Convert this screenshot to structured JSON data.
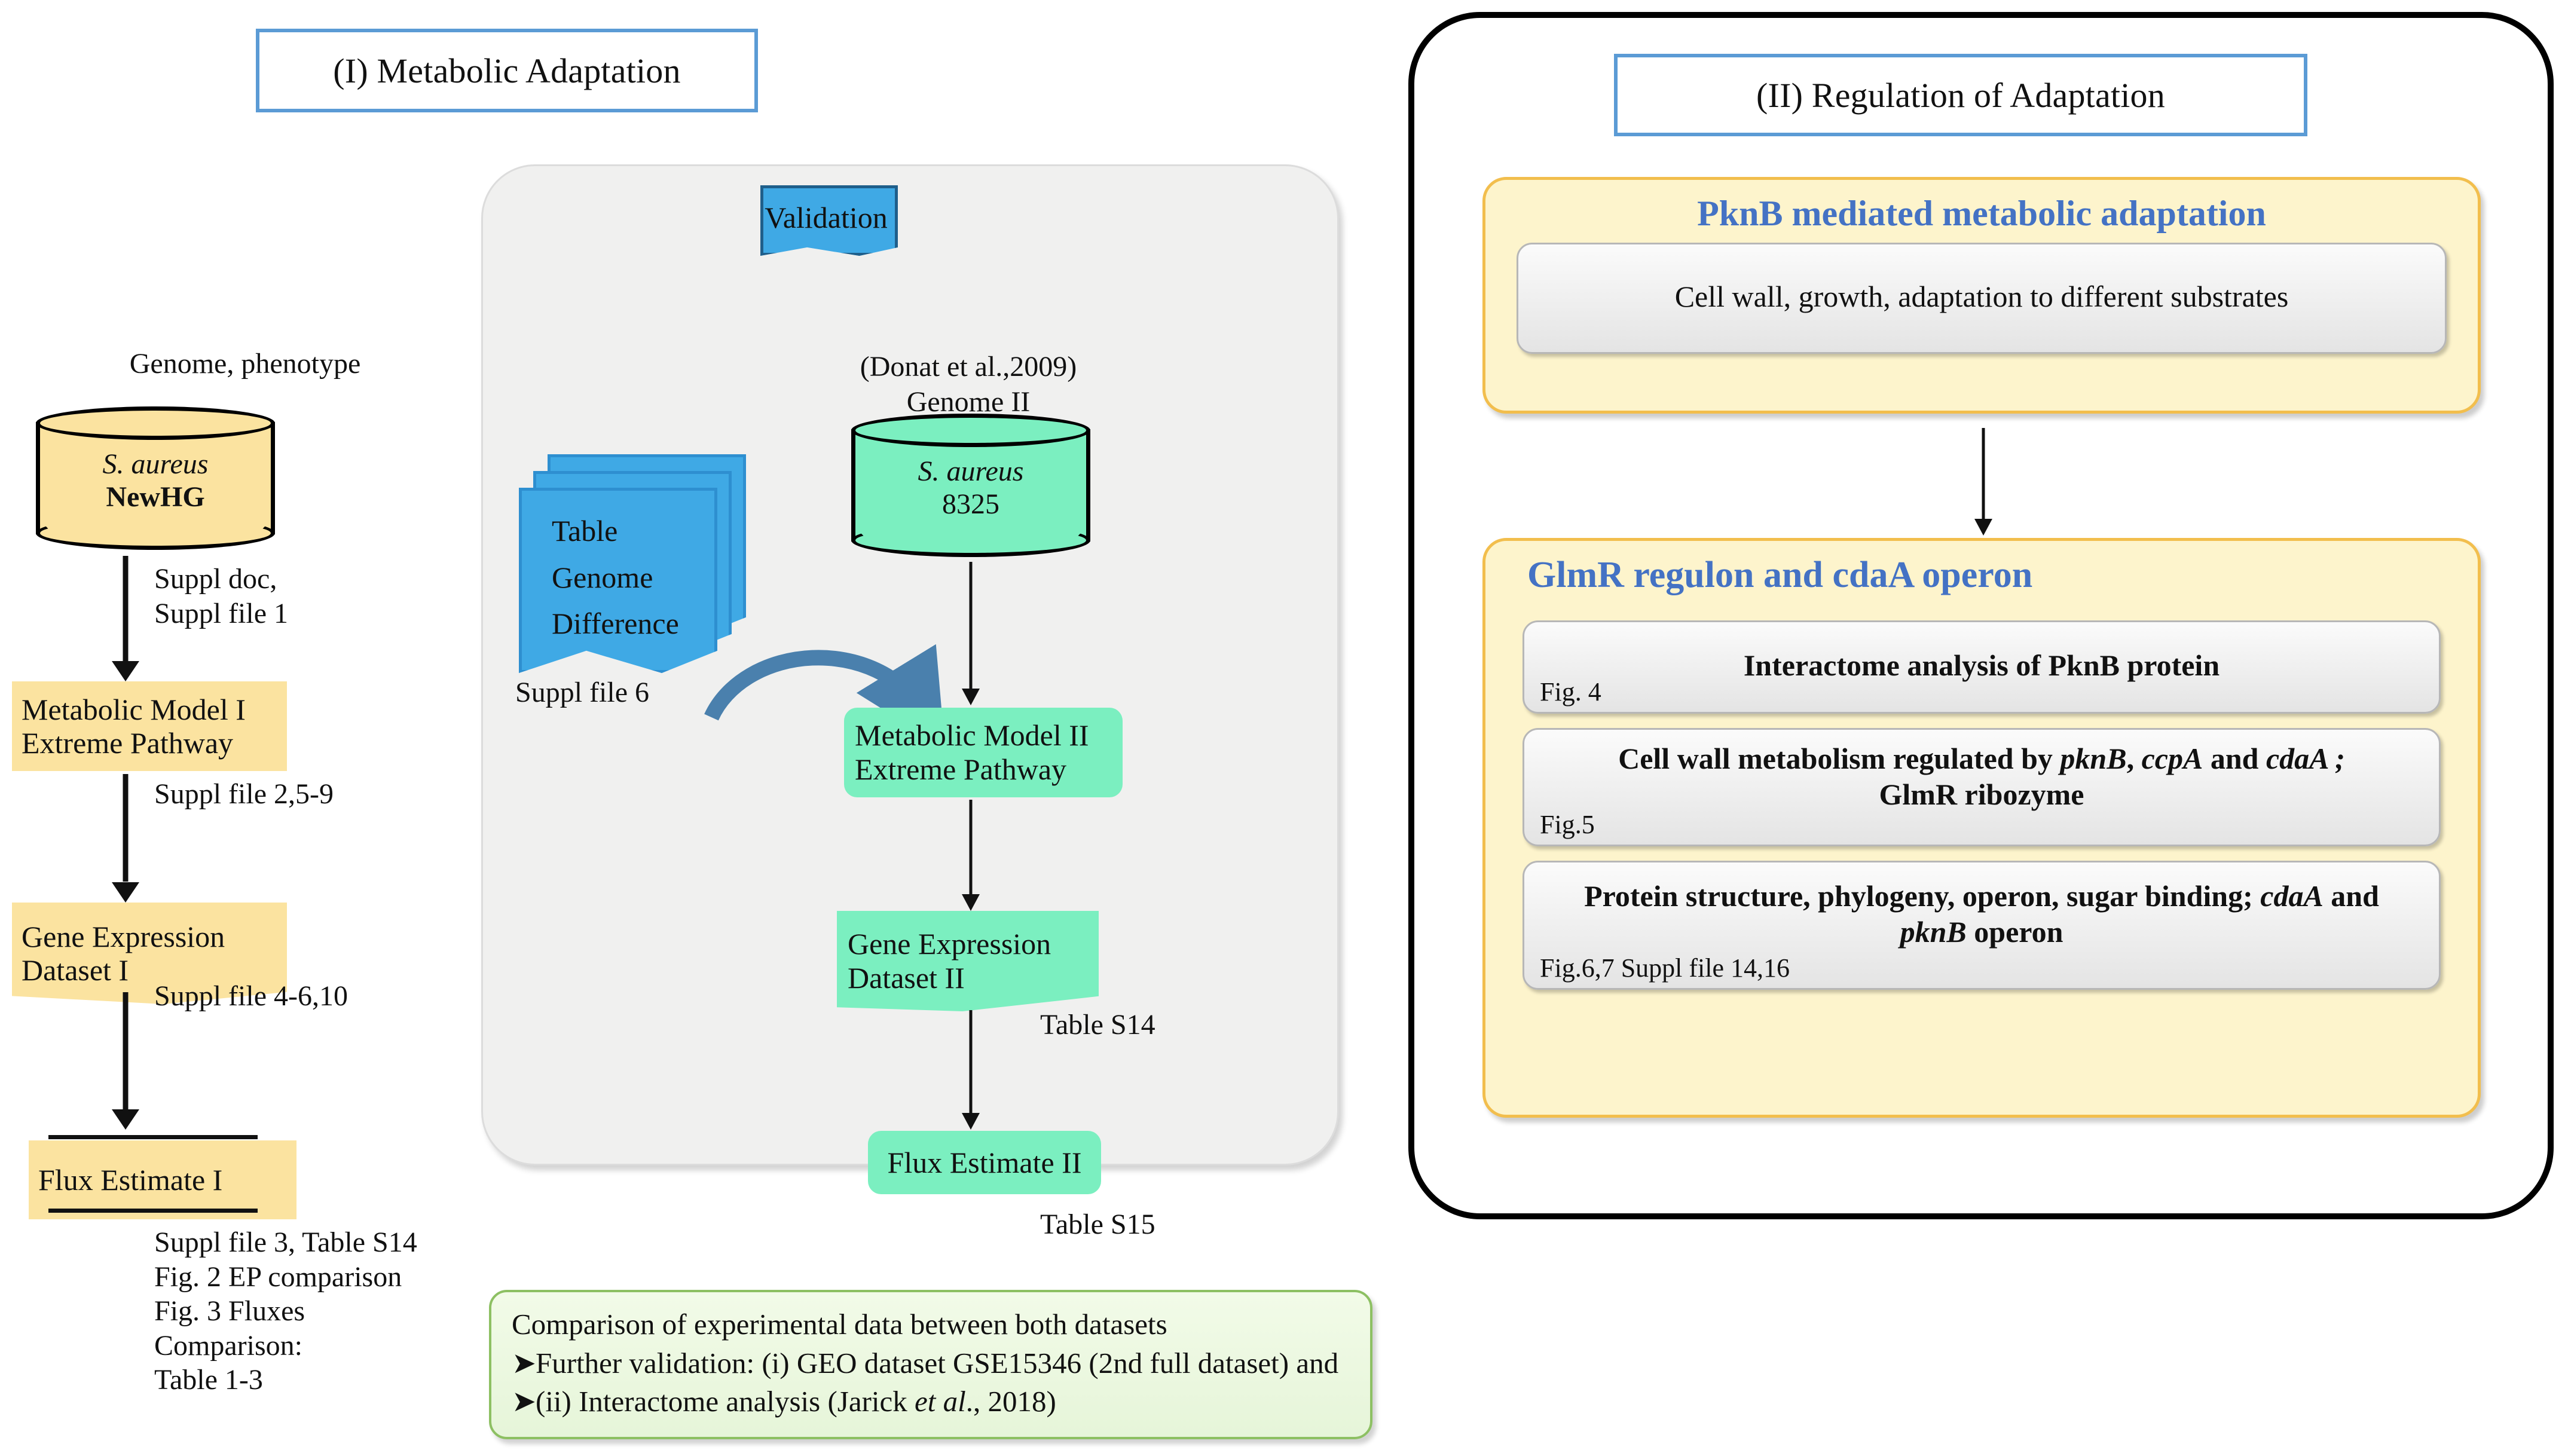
{
  "sections": {
    "left_title": "(I) Metabolic Adaptation",
    "right_title": "(II) Regulation of Adaptation"
  },
  "left_flow": {
    "genome_caption": "Genome, phenotype",
    "db": {
      "species": "S. aureus",
      "strain": "NewHG"
    },
    "edge1": "Suppl doc,\nSuppl file 1",
    "box1": {
      "line1": "Metabolic Model I",
      "line2": "Extreme Pathway"
    },
    "edge2": "Suppl file 2,5-9",
    "box2": {
      "line1": "Gene Expression",
      "line2": "Dataset I"
    },
    "edge3": "Suppl file 4-6,10",
    "box3": {
      "line1": "Flux Estimate I"
    },
    "footnotes": "Suppl file 3, Table S14\nFig. 2 EP comparison\nFig. 3 Fluxes\nComparison:\nTable 1-3"
  },
  "validation_panel": {
    "badge": "Validation",
    "docs": {
      "line1": "Table",
      "line2": "Genome",
      "line3": "Difference",
      "caption": "Suppl file 6"
    },
    "db": {
      "citation": "(Donat et  al.,2009)",
      "label": "Genome II",
      "species": "S. aureus",
      "strain": "8325"
    },
    "box1": {
      "line1": "Metabolic Model II",
      "line2": "Extreme Pathway"
    },
    "box2": {
      "line1": "Gene Expression",
      "line2": "Dataset II",
      "caption": "Table S14"
    },
    "box3": {
      "line1": "Flux Estimate II",
      "caption": "Table S15"
    }
  },
  "right_panel": {
    "pknb": {
      "heading": "PknB mediated metabolic adaptation",
      "pill": "Cell wall, growth, adaptation to different substrates"
    },
    "glmr": {
      "heading": "GlmR regulon and cdaA operon",
      "items": [
        {
          "text_html": "Interactome analysis of PknB protein",
          "fig": "Fig. 4"
        },
        {
          "text_html": "Cell wall metabolism regulated by <i>pknB</i>, <i>ccpA</i> and <i>cdaA ;</i><br>GlmR ribozyme",
          "fig": "Fig.5"
        },
        {
          "text_html": "Protein structure, phylogeny, operon, sugar binding; <i>cdaA</i> and<br><i>pknB</i>  operon",
          "fig": "Fig.6,7 Suppl file 14,16"
        }
      ]
    }
  },
  "bottom_box": {
    "line1": "Comparison of experimental data between both datasets",
    "bullet": "➤",
    "line2": "Further validation: (i) GEO dataset GSE15346 (2nd full dataset) and",
    "line3_html": "(ii) Interactome analysis (Jarick <i>et al</i>., 2018)"
  },
  "colors": {
    "yellow_fill": "#fbe3a0",
    "teal_fill": "#7befc0",
    "blue_doc": "#3fa9e5",
    "title_border": "#5b9bd5",
    "panel_yellow": "#fdf4cc",
    "panel_yellow_border": "#f2be4d",
    "heading_blue": "#4472c4",
    "green_fill": "#e6f5d9",
    "green_border": "#8dc063",
    "grey_panel": "#f0f0ef"
  }
}
